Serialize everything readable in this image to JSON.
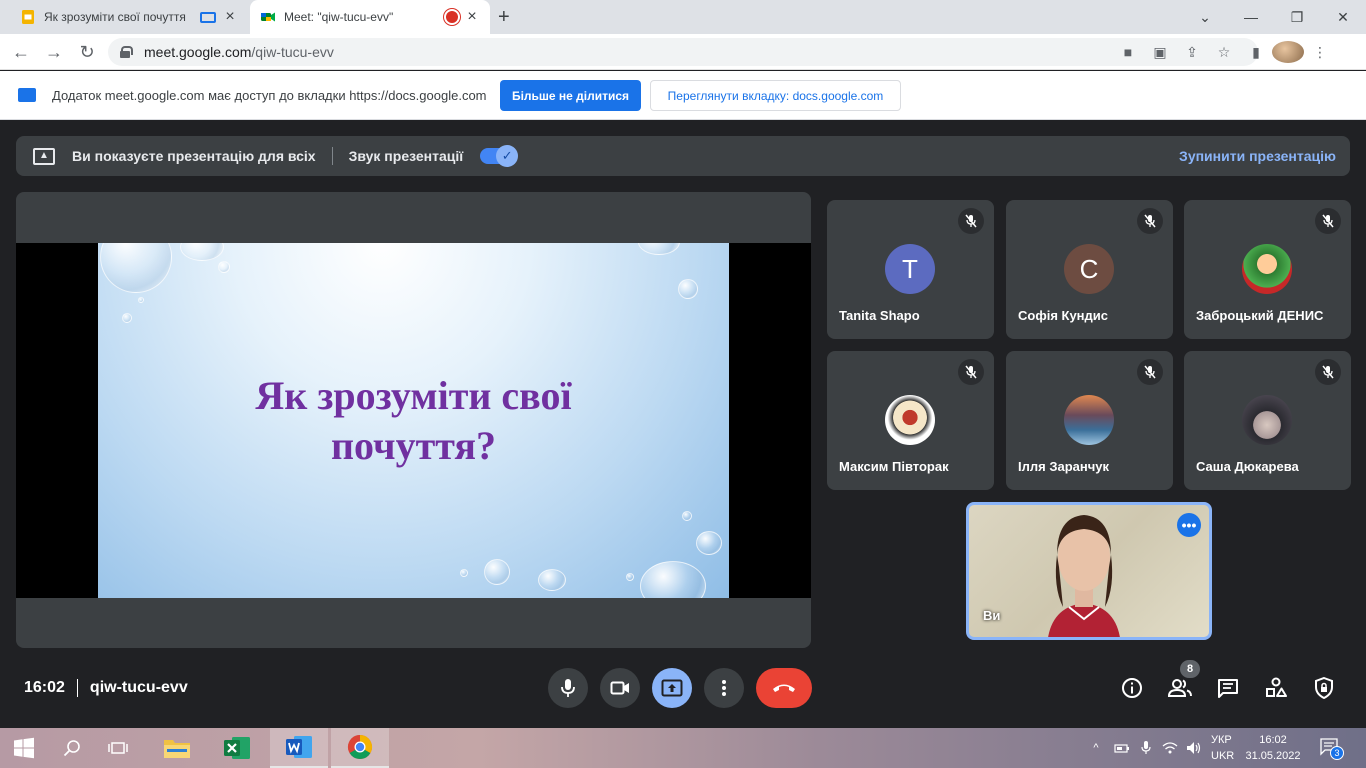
{
  "browser": {
    "tabs": [
      {
        "title": "Як зрозуміти свої почуття",
        "active": false
      },
      {
        "title": "Meet: \"qiw-tucu-evv\"",
        "active": true
      }
    ],
    "url_host": "meet.google.com",
    "url_path": "/qiw-tucu-evv"
  },
  "infobar": {
    "text": "Додаток meet.google.com має доступ до вкладки https://docs.google.com",
    "stop_sharing_label": "Більше не ділитися",
    "view_tab_label": "Переглянути вкладку: docs.google.com"
  },
  "present_bar": {
    "status_text": "Ви показуєте презентацію для всіх",
    "audio_label": "Звук презентації",
    "audio_enabled": true,
    "stop_label": "Зупинити презентацію"
  },
  "slide": {
    "title_line1": "Як зрозуміти свої",
    "title_line2": "почуття?"
  },
  "participants": [
    {
      "name": "Tanita Shapo",
      "initial": "T",
      "color": "#5c6bc0",
      "muted": true
    },
    {
      "name": "Софія Кундис",
      "initial": "С",
      "color": "#6d4c41",
      "muted": true
    },
    {
      "name": "Заброцький ДЕНИС",
      "initial": "",
      "color": "#2e7d32",
      "muted": true
    },
    {
      "name": "Максим Півторак",
      "initial": "",
      "color": "#ffffff",
      "muted": true
    },
    {
      "name": "Ілля Заранчук",
      "initial": "",
      "color": "#3b6f99",
      "muted": true
    },
    {
      "name": "Саша Дюкарева",
      "initial": "",
      "color": "#6e6a70",
      "muted": true
    }
  ],
  "self": {
    "name": "Ви"
  },
  "meeting": {
    "time": "16:02",
    "code": "qiw-tucu-evv",
    "participant_count": "8"
  },
  "taskbar": {
    "lang_top": "УКР",
    "lang_bottom": "UKR",
    "clock_time": "16:02",
    "clock_date": "31.05.2022",
    "notifications": "3"
  }
}
